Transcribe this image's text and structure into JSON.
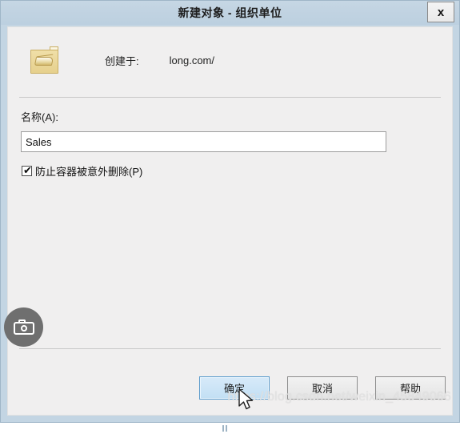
{
  "window": {
    "title": "新建对象 - 组织单位",
    "close_label": "x"
  },
  "header": {
    "icon_name": "organizational-unit-folder-icon",
    "created_in_label": "创建于:",
    "created_in_value": "long.com/"
  },
  "form": {
    "name_label": "名称(A):",
    "name_value": "Sales",
    "name_placeholder": "",
    "protect_checkbox_label": "防止容器被意外删除(P)",
    "protect_checkbox_checked": "✔"
  },
  "overlay": {
    "camera_button_name": "camera-icon"
  },
  "footer": {
    "ok_label": "确定",
    "cancel_label": "取消",
    "help_label": "帮助"
  },
  "watermark": {
    "text": "https://blog.csdn.net/weixin_45849066"
  },
  "colors": {
    "titlebar": "#c3d5e3",
    "client_background": "#f0efef",
    "default_button_fill": "#c9e2f6",
    "default_button_border": "#5c9ccc",
    "button_fill": "#e9e9e9",
    "icon_folder": "#e6d08d",
    "camera_button": "#6f6f6f"
  }
}
